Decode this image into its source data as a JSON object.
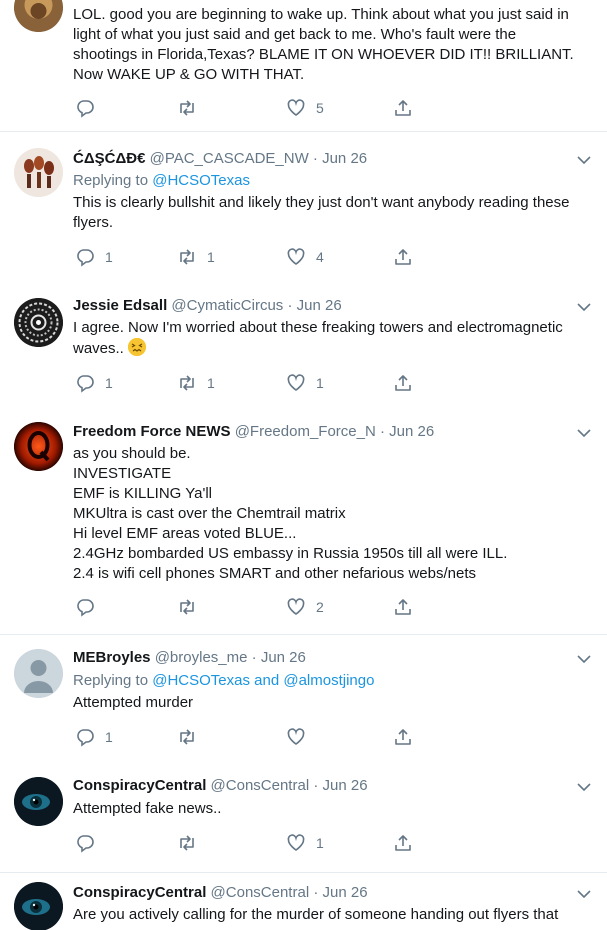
{
  "tweets": [
    {
      "id": "t0",
      "lines": [
        "LOL. good you are beginning to wake up. Think about what you just said in",
        "light of what you just said and get back to me. Who's fault were the",
        "shootings in Florida,Texas? BLAME IT ON WHOEVER DID IT!! BRILLIANT.",
        "Now WAKE UP & GO WITH THAT."
      ],
      "reply_count": "",
      "retweet_count": "",
      "like_count": "5",
      "avatar_icon": "lion-avatar-icon"
    },
    {
      "id": "t1",
      "name": "ĆΔŞĆΔÐ€",
      "handle": "@PAC_CASCADE_NW",
      "dot": "·",
      "date": "Jun 26",
      "replying_prefix": "Replying to ",
      "replying_to": "@HCSOTexas",
      "lines": [
        "This is clearly bullshit and likely they just don't want anybody reading these",
        "flyers."
      ],
      "reply_count": "1",
      "retweet_count": "1",
      "like_count": "4",
      "avatar_icon": "skulls-avatar-icon"
    },
    {
      "id": "t2",
      "name": "Jessie Edsall",
      "handle": "@CymaticCircus",
      "dot": "·",
      "date": "Jun 26",
      "lines": [
        "I agree. Now I'm worried about these freaking towers and electromagnetic",
        "waves.."
      ],
      "reply_count": "1",
      "retweet_count": "1",
      "like_count": "1",
      "avatar_icon": "cymatic-pattern-avatar-icon",
      "emoji_icon": "confounded-face-icon"
    },
    {
      "id": "t3",
      "name": "Freedom Force NEWS",
      "handle": "@Freedom_Force_N",
      "dot": "·",
      "date": "Jun 26",
      "lines": [
        "as you should be.",
        "INVESTIGATE",
        "EMF is KILLING Ya'll",
        "MKUltra is cast over the Chemtrail matrix",
        "Hi level EMF areas voted BLUE...",
        "2.4GHz bombarded US embassy in Russia 1950s till all were ILL.",
        "2.4 is wifi cell phones SMART and other nefarious webs/nets"
      ],
      "reply_count": "",
      "retweet_count": "",
      "like_count": "2",
      "avatar_icon": "q-logo-avatar-icon"
    },
    {
      "id": "t4",
      "name": "MEBroyles",
      "handle": "@broyles_me",
      "dot": "·",
      "date": "Jun 26",
      "replying_prefix": "Replying to ",
      "replying_to": "@HCSOTexas",
      "replying_and": " and ",
      "replying_to2": "@almostjingo",
      "lines": [
        "Attempted murder"
      ],
      "reply_count": "1",
      "retweet_count": "",
      "like_count": "",
      "avatar_icon": "default-profile-avatar-icon"
    },
    {
      "id": "t5",
      "name": "ConspiracyCentral",
      "handle": "@ConsCentral",
      "dot": "·",
      "date": "Jun 26",
      "lines": [
        "Attempted fake news.."
      ],
      "reply_count": "",
      "retweet_count": "",
      "like_count": "1",
      "avatar_icon": "eye-avatar-icon"
    },
    {
      "id": "t6",
      "name": "ConspiracyCentral",
      "handle": "@ConsCentral",
      "dot": "·",
      "date": "Jun 26",
      "lines": [
        "Are you actively calling for the murder of someone handing out flyers that"
      ],
      "avatar_icon": "eye-avatar-icon"
    }
  ],
  "colors": {
    "link": "#1b95e0",
    "secondary_text": "#657786",
    "divider": "#e6ecf0"
  }
}
